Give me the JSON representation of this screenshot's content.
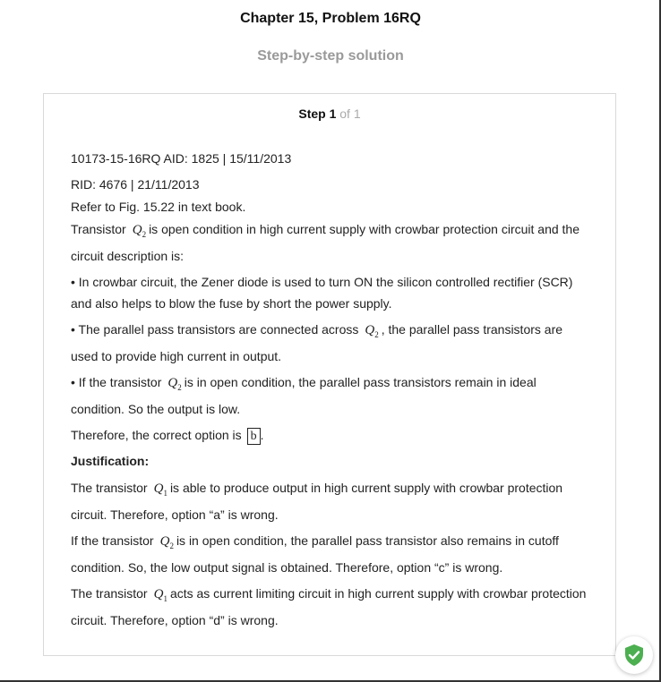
{
  "header": {
    "title": "Chapter 15, Problem 16RQ",
    "subtitle": "Step-by-step solution"
  },
  "step": {
    "label": "Step 1",
    "of": "of 1"
  },
  "solution": {
    "aid_line": "10173-15-16RQ AID: 1825 | 15/11/2013",
    "rid_line": "RID: 4676 | 21/11/2013",
    "refer": "Refer to Fig. 15.22 in text book.",
    "intro_a": "Transistor",
    "intro_b": "is open condition in high current supply with crowbar protection circuit and the circuit description is:",
    "bullet1": "• In crowbar circuit, the Zener diode is used to turn ON the silicon controlled rectifier (SCR) and also helps to blow the fuse by short the power supply.",
    "bullet2_a": "• The parallel pass transistors are connected across",
    "bullet2_b": ", the parallel pass transistors are used to provide high current in output.",
    "bullet3_a": "• If the transistor",
    "bullet3_b": "is in open condition, the parallel pass transistors remain in ideal condition. So the output is low.",
    "answer_a": "Therefore, the correct option is",
    "answer_option": "b",
    "answer_end": ".",
    "justification_heading": "Justification:",
    "just1_a": "The transistor",
    "just1_b": "is able to produce output in high current supply with crowbar protection circuit. Therefore, option “a” is wrong.",
    "just2_a": "If the transistor",
    "just2_b": "is in open condition, the parallel pass transistor also remains in cutoff condition. So, the low output signal is obtained. Therefore, option “c” is wrong.",
    "just3_a": "The transistor",
    "just3_b": "acts as current limiting circuit in high current supply with crowbar protection circuit. Therefore, option “d” is wrong."
  },
  "symbols": {
    "Q": "Q",
    "sub1": "1",
    "sub2": "2"
  },
  "icons": {
    "badge": "shield-check-icon",
    "badge_color": "#4caf50"
  }
}
